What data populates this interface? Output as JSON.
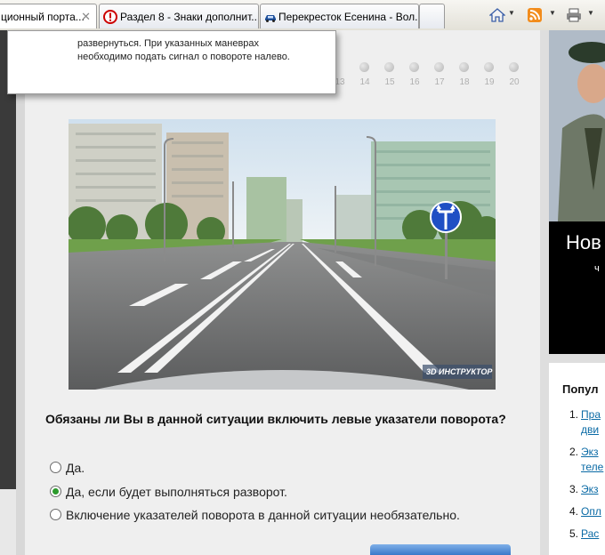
{
  "tabs": [
    {
      "title": "ционный порта...",
      "active": true
    },
    {
      "title": "Раздел 8 - Знаки дополнит...",
      "active": false
    },
    {
      "title": "Перекресток Есенина - Вол...",
      "active": false
    }
  ],
  "popup": {
    "lines": [
      "развернуться. При указанных маневрах",
      "необходимо подать сигнал о повороте налево."
    ]
  },
  "pager": {
    "numbers": [
      "13",
      "14",
      "15",
      "16",
      "17",
      "18",
      "19",
      "20"
    ]
  },
  "scene": {
    "watermark": "3D ИНСТРУКТОР"
  },
  "question": {
    "text": "Обязаны ли Вы в данной ситуации включить левые указатели поворота?",
    "answers": [
      {
        "label": "Да.",
        "selected": false
      },
      {
        "label": "Да, если будет выполняться разворот.",
        "selected": true
      },
      {
        "label": "Включение указателей поворота в данной ситуации необязательно.",
        "selected": false
      }
    ]
  },
  "ad": {
    "text_large": "Нов",
    "text_small": "ч"
  },
  "popular": {
    "title": "Попул",
    "items": [
      {
        "num": "1.",
        "text": "Пра"
      },
      {
        "num": "",
        "text": "дви"
      },
      {
        "num": "2.",
        "text": "Экз"
      },
      {
        "num": "",
        "text": "теле"
      },
      {
        "num": "3.",
        "text": "Экз"
      },
      {
        "num": "4.",
        "text": "Опл"
      },
      {
        "num": "5.",
        "text": "Рас"
      }
    ]
  },
  "colors": {
    "link": "#0a6aa5",
    "radio_selected": "#2c9a2c",
    "sign_blue": "#1f4fc4"
  }
}
